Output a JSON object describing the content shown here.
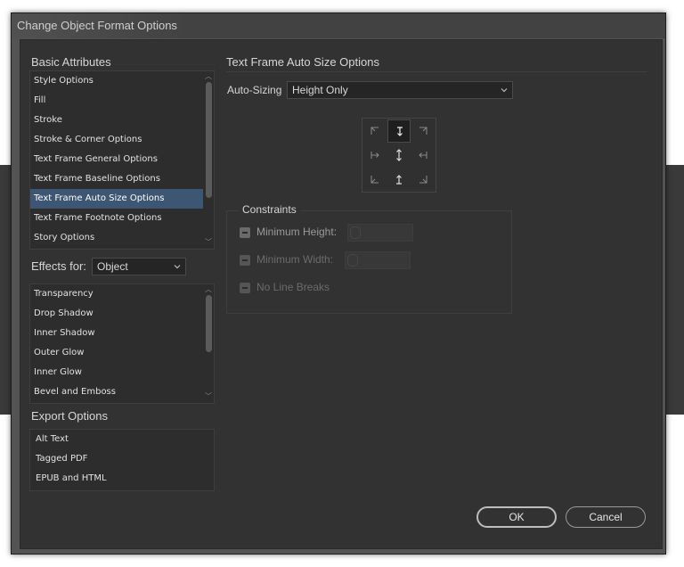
{
  "window": {
    "title": "Change Object Format Options"
  },
  "left": {
    "basic_title": "Basic Attributes",
    "basic_items": [
      {
        "label": "Style Options"
      },
      {
        "label": "Fill"
      },
      {
        "label": "Stroke"
      },
      {
        "label": "Stroke & Corner Options"
      },
      {
        "label": "Text Frame General Options"
      },
      {
        "label": "Text Frame Baseline Options"
      },
      {
        "label": "Text Frame Auto Size Options",
        "selected": true
      },
      {
        "label": "Text Frame Footnote Options"
      },
      {
        "label": "Story Options"
      }
    ],
    "effects_for_label": "Effects for:",
    "effects_for_value": "Object",
    "effects_items": [
      {
        "label": "Transparency"
      },
      {
        "label": "Drop Shadow"
      },
      {
        "label": "Inner Shadow"
      },
      {
        "label": "Outer Glow"
      },
      {
        "label": "Inner Glow"
      },
      {
        "label": "Bevel and Emboss"
      }
    ],
    "export_title": "Export Options",
    "export_items": [
      {
        "label": "Alt Text"
      },
      {
        "label": "Tagged PDF"
      },
      {
        "label": "EPUB and HTML"
      }
    ]
  },
  "right": {
    "section_title": "Text Frame Auto Size Options",
    "auto_sizing_label": "Auto-Sizing",
    "auto_sizing_value": "Height Only",
    "reference_point_icons": [
      "top-left-corner-arrow-icon",
      "down-arrow-icon",
      "top-right-corner-arrow-icon",
      "left-arrow-icon",
      "vertical-arrows-icon",
      "right-arrow-icon",
      "bottom-left-corner-arrow-icon",
      "up-arrow-icon",
      "bottom-right-corner-arrow-icon"
    ],
    "active_reference_point": "down-arrow-icon",
    "constraints": {
      "title": "Constraints",
      "min_height_label": "Minimum Height:",
      "min_width_label": "Minimum Width:",
      "no_line_breaks_label": "No Line Breaks"
    }
  },
  "buttons": {
    "ok": "OK",
    "cancel": "Cancel"
  },
  "colors": {
    "background": "#323232",
    "selection": "#3d5674",
    "titlebar": "#424242"
  }
}
